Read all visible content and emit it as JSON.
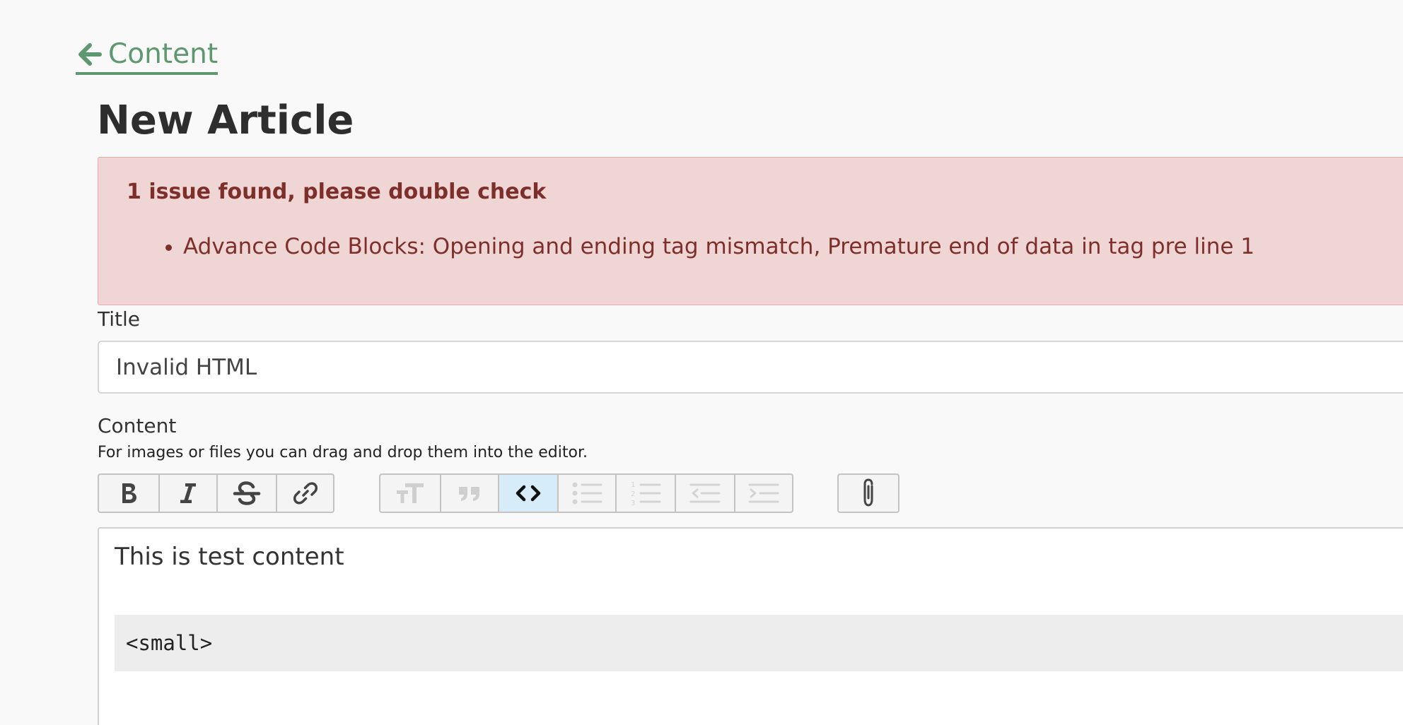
{
  "nav": {
    "back_label": "Content",
    "back_icon": "arrow-left-icon"
  },
  "page": {
    "title": "New Article"
  },
  "alert": {
    "heading": "1 issue found, please double check",
    "issues": [
      "Advance Code Blocks: Opening and ending tag mismatch, Premature end of data in tag pre line 1"
    ]
  },
  "form": {
    "title_label": "Title",
    "title_value": "Invalid HTML",
    "content_label": "Content",
    "content_hint": "For images or files you can drag and drop them into the editor."
  },
  "toolbar": {
    "groups": [
      {
        "buttons": [
          {
            "icon": "bold-icon",
            "title": "Bold"
          },
          {
            "icon": "italic-icon",
            "title": "Italic"
          },
          {
            "icon": "strikethrough-icon",
            "title": "Strikethrough"
          },
          {
            "icon": "link-icon",
            "title": "Link"
          }
        ]
      },
      {
        "buttons": [
          {
            "icon": "heading-icon",
            "title": "Heading",
            "disabled": true
          },
          {
            "icon": "quote-icon",
            "title": "Quote",
            "disabled": true
          },
          {
            "icon": "code-icon",
            "title": "Code",
            "active": true
          },
          {
            "icon": "bullet-list-icon",
            "title": "Bullets",
            "disabled": true
          },
          {
            "icon": "numbered-list-icon",
            "title": "Numbers",
            "disabled": true
          },
          {
            "icon": "decrease-indent-icon",
            "title": "Decrease Level",
            "disabled": true
          },
          {
            "icon": "increase-indent-icon",
            "title": "Increase Level",
            "disabled": true
          }
        ]
      },
      {
        "buttons": [
          {
            "icon": "attach-icon",
            "title": "Attach Files"
          }
        ]
      }
    ]
  },
  "editor": {
    "paragraph": "This is test content",
    "code": "<small>"
  },
  "colors": {
    "accent": "#5e9870",
    "alert_bg": "#efd6d4",
    "alert_text": "#7e2f2c",
    "active_button": "#d6ecf8"
  }
}
